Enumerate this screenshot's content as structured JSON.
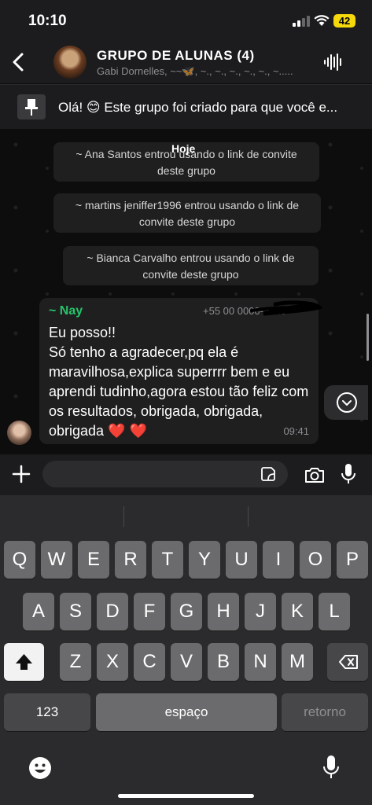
{
  "status_bar": {
    "time": "10:10",
    "battery": "42"
  },
  "header": {
    "title": "GRUPO DE ALUNAS  (4)",
    "subtitle": "Gabi Dornelles, ~~🦋, ~., ~., ~., ~., ~., ~....."
  },
  "pinned": {
    "text": "Olá! 😊 Este grupo foi criado para que você e..."
  },
  "chat": {
    "day_label": "Hoje",
    "system_messages": [
      "~ Ana Santos entrou usando o link de convite deste grupo",
      "~ martins jeniffer1996 entrou usando o link de convite deste grupo",
      "~ Bianca Carvalho entrou usando o link de convite deste grupo"
    ],
    "message": {
      "sender": "~ Nay",
      "phone": "+55 00 0000-2710",
      "text": "Eu posso!!\nSó tenho a agradecer,pq ela é maravilhosa,explica superrrr bem e eu aprendi tudinho,agora estou tão feliz com os resultados, obrigada, obrigada, obrigada ❤️ ❤️",
      "time": "09:41"
    }
  },
  "input": {
    "placeholder": ""
  },
  "keyboard": {
    "row1": [
      "Q",
      "W",
      "E",
      "R",
      "T",
      "Y",
      "U",
      "I",
      "O",
      "P"
    ],
    "row2": [
      "A",
      "S",
      "D",
      "F",
      "G",
      "H",
      "J",
      "K",
      "L"
    ],
    "row3": [
      "Z",
      "X",
      "C",
      "V",
      "B",
      "N",
      "M"
    ],
    "numbers_label": "123",
    "space_label": "espaço",
    "return_label": "retorno"
  },
  "colors": {
    "accent_green": "#25c46b",
    "battery_yellow": "#f5d90a",
    "heart": "#e0242e"
  }
}
